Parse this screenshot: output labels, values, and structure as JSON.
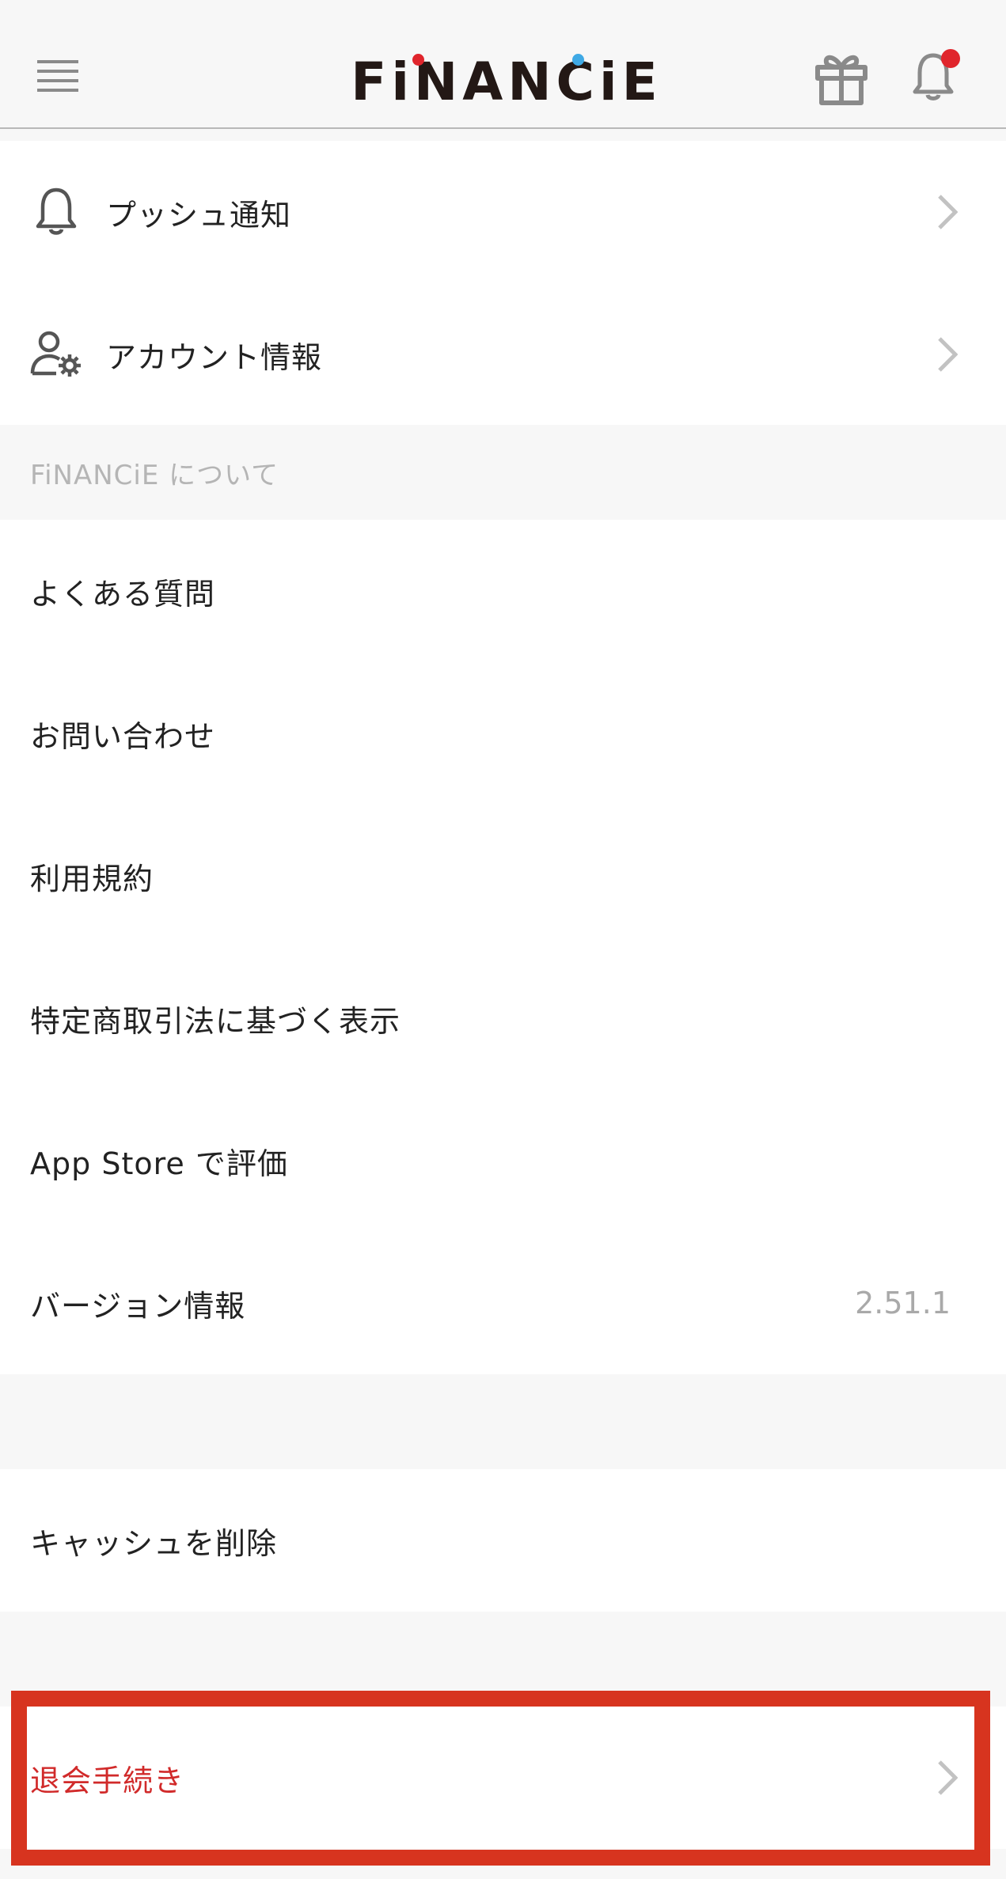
{
  "header": {
    "logo_text": "FiNANCiE",
    "menu_icon": "hamburger-menu-icon",
    "gift_icon": "gift-icon",
    "bell_icon": "bell-icon",
    "colors": {
      "logo": "#231815",
      "logo_dot_red": "#e0252c",
      "logo_dot_blue": "#3fa9e5",
      "badge": "#e0252c"
    }
  },
  "settings": {
    "push": {
      "label": "プッシュ通知",
      "icon": "bell-icon"
    },
    "account": {
      "label": "アカウント情報",
      "icon": "user-gear-icon"
    }
  },
  "about": {
    "section_title": "FiNANCiE について",
    "items": [
      {
        "label": "よくある質問"
      },
      {
        "label": "お問い合わせ"
      },
      {
        "label": "利用規約"
      },
      {
        "label": "特定商取引法に基づく表示"
      },
      {
        "label": "App Store で評価"
      },
      {
        "label": "バージョン情報",
        "value": "2.51.1"
      }
    ]
  },
  "cache": {
    "label": "キャッシュを削除"
  },
  "withdraw": {
    "label": "退会手続き",
    "color": "#d12a2a"
  },
  "highlight_color": "#d7341f"
}
